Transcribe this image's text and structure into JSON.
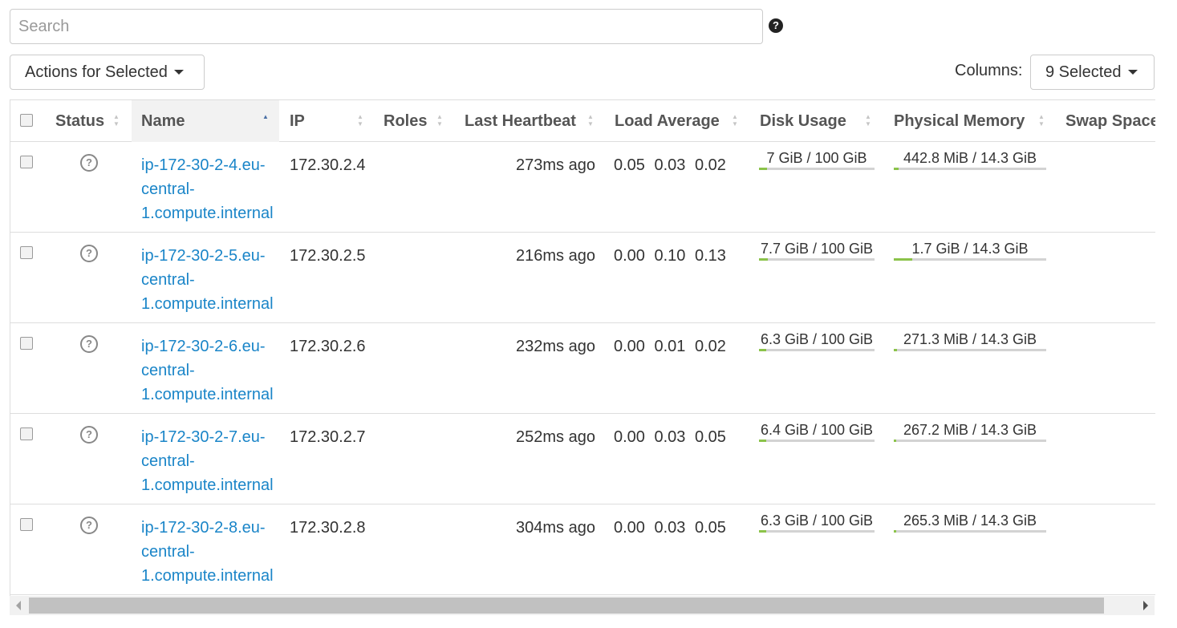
{
  "search": {
    "placeholder": "Search"
  },
  "help_icon": "question-circle-icon",
  "toolbar": {
    "actions_label": "Actions for Selected",
    "columns_label": "Columns:",
    "columns_selected": "9 Selected"
  },
  "table": {
    "columns": {
      "status": "Status",
      "name": "Name",
      "ip": "IP",
      "roles": "Roles",
      "heartbeat": "Last Heartbeat",
      "load": "Load Average",
      "disk": "Disk Usage",
      "memory": "Physical Memory",
      "swap": "Swap Space"
    },
    "sorted_column": "name",
    "rows": [
      {
        "name_parts": [
          "ip-172-30-2-4.eu-",
          "central-",
          "1.compute.internal"
        ],
        "ip": "172.30.2.4",
        "heartbeat": "273ms ago",
        "load": "0.05 0.03 0.02",
        "disk": "7 GiB / 100 GiB",
        "disk_pct": 7,
        "memory": "442.8 MiB / 14.3 GiB",
        "memory_pct": 3
      },
      {
        "name_parts": [
          "ip-172-30-2-5.eu-",
          "central-",
          "1.compute.internal"
        ],
        "ip": "172.30.2.5",
        "heartbeat": "216ms ago",
        "load": "0.00 0.10 0.13",
        "disk": "7.7 GiB / 100 GiB",
        "disk_pct": 7.7,
        "memory": "1.7 GiB / 14.3 GiB",
        "memory_pct": 12
      },
      {
        "name_parts": [
          "ip-172-30-2-6.eu-",
          "central-",
          "1.compute.internal"
        ],
        "ip": "172.30.2.6",
        "heartbeat": "232ms ago",
        "load": "0.00 0.01 0.02",
        "disk": "6.3 GiB / 100 GiB",
        "disk_pct": 6.3,
        "memory": "271.3 MiB / 14.3 GiB",
        "memory_pct": 1.9
      },
      {
        "name_parts": [
          "ip-172-30-2-7.eu-",
          "central-",
          "1.compute.internal"
        ],
        "ip": "172.30.2.7",
        "heartbeat": "252ms ago",
        "load": "0.00 0.03 0.05",
        "disk": "6.4 GiB / 100 GiB",
        "disk_pct": 6.4,
        "memory": "267.2 MiB / 14.3 GiB",
        "memory_pct": 1.8
      },
      {
        "name_parts": [
          "ip-172-30-2-8.eu-",
          "central-",
          "1.compute.internal"
        ],
        "ip": "172.30.2.8",
        "heartbeat": "304ms ago",
        "load": "0.00 0.03 0.05",
        "disk": "6.3 GiB / 100 GiB",
        "disk_pct": 6.3,
        "memory": "265.3 MiB / 14.3 GiB",
        "memory_pct": 1.8
      }
    ]
  },
  "status_icon": "question-circle-icon",
  "colors": {
    "link": "#1a85c8",
    "bar_fill": "#8bc34a",
    "bar_track": "#d3d3d3"
  }
}
